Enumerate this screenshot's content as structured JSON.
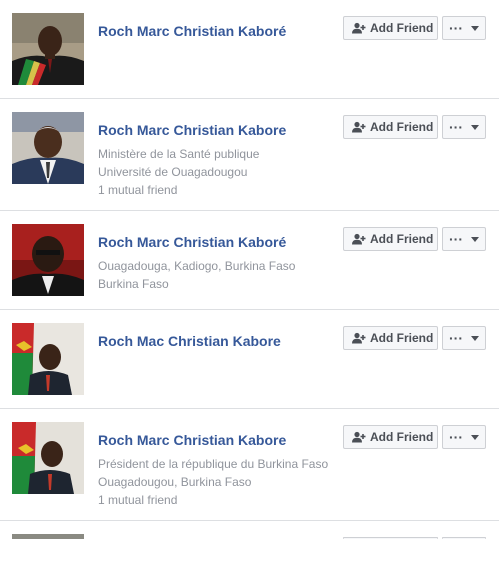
{
  "results": [
    {
      "name": "Roch Marc Christian Kaboré",
      "details": [],
      "add_friend_label": "Add Friend",
      "more_label": "···"
    },
    {
      "name": "Roch Marc Christian Kabore",
      "details": [
        "Ministère de la Santé publique",
        "Université de Ouagadougou",
        "1 mutual friend"
      ],
      "add_friend_label": "Add Friend",
      "more_label": "···"
    },
    {
      "name": "Roch Marc Christian Kaboré",
      "details": [
        "Ouagadouga, Kadiogo, Burkina Faso",
        "Burkina Faso"
      ],
      "add_friend_label": "Add Friend",
      "more_label": "···"
    },
    {
      "name": "Roch Mac Christian Kabore",
      "details": [],
      "add_friend_label": "Add Friend",
      "more_label": "···"
    },
    {
      "name": "Roch Marc Christian Kabore",
      "details": [
        "Président de la république du Burkina Faso",
        "Ouagadougou, Burkina Faso",
        "1 mutual friend"
      ],
      "add_friend_label": "Add Friend",
      "more_label": "···"
    }
  ],
  "colors": {
    "name_link": "#365899",
    "secondary_text": "#90949c",
    "button_bg": "#f6f7f9",
    "button_border": "#ced0d4",
    "divider": "#dddfe2"
  },
  "icons": {
    "add_friend": "add-friend-icon",
    "more": "more-options-icon",
    "caret": "caret-down-icon"
  }
}
